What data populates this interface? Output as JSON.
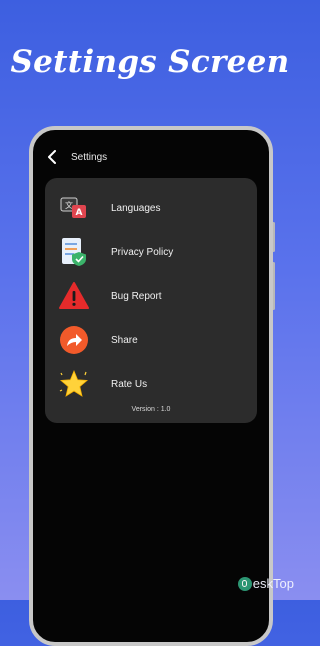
{
  "banner": {
    "title": "Settings Screen"
  },
  "header": {
    "title": "Settings",
    "back_icon": "back-arrow-icon"
  },
  "menu": {
    "items": [
      {
        "label": "Languages",
        "icon": "translate-icon"
      },
      {
        "label": "Privacy Policy",
        "icon": "document-shield-icon"
      },
      {
        "label": "Bug Report",
        "icon": "warning-triangle-icon"
      },
      {
        "label": "Share",
        "icon": "share-arrow-icon"
      },
      {
        "label": "Rate Us",
        "icon": "star-icon"
      }
    ],
    "version": "Version : 1.0"
  },
  "watermark": {
    "text": "eskTop"
  },
  "colors": {
    "background_top": "#3d5fe0",
    "background_bottom": "#8a8ef0",
    "screen": "#050505",
    "card": "#2c2c2c",
    "warning": "#e52b2b",
    "share": "#f25a2a",
    "star": "#ffd23a"
  }
}
